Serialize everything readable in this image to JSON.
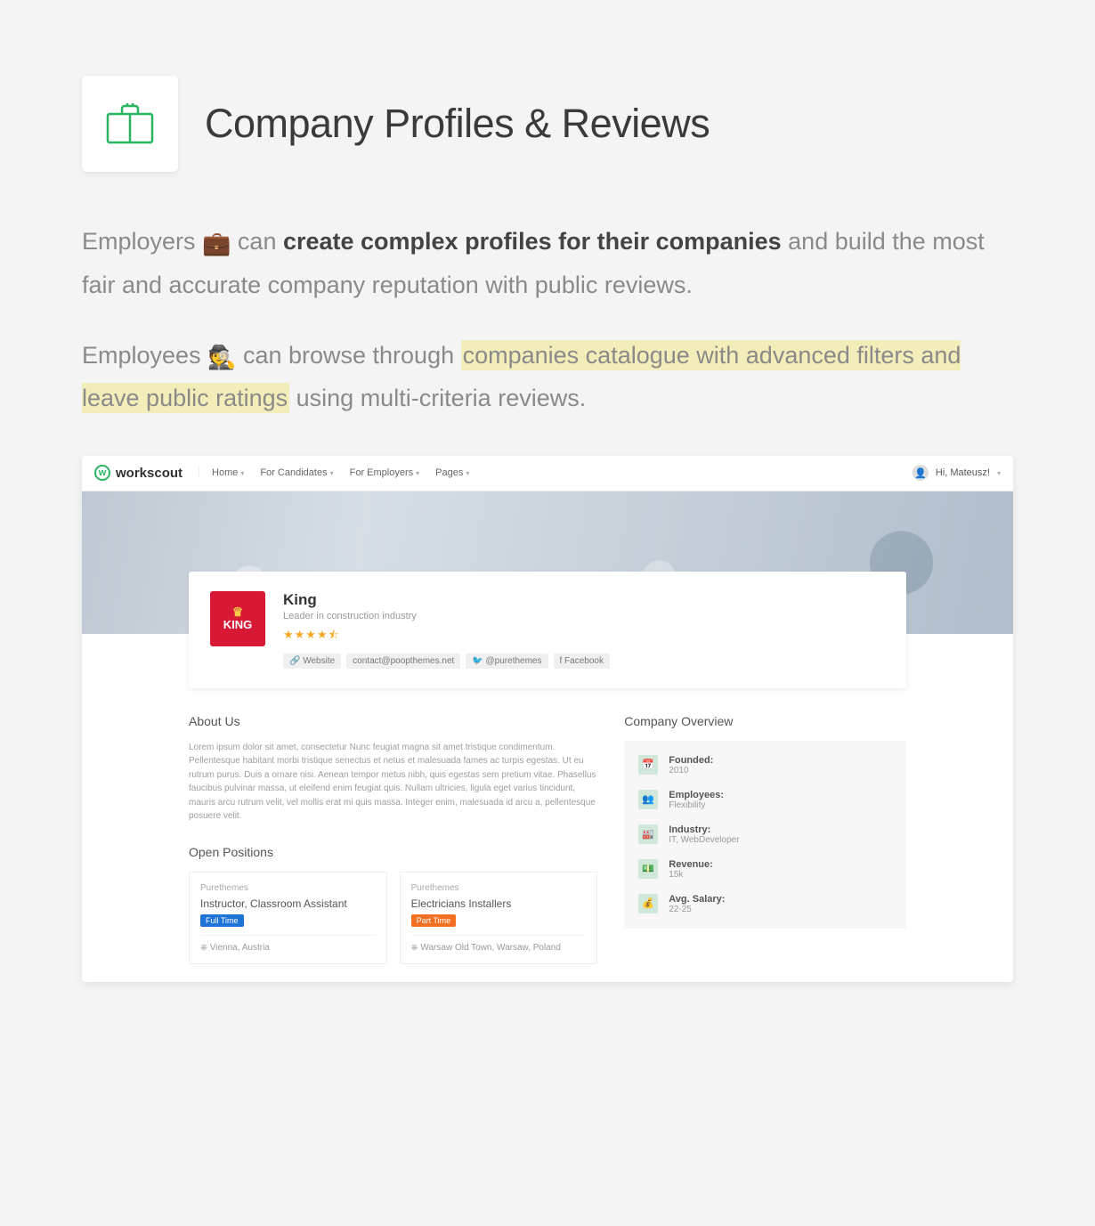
{
  "header": {
    "title": "Company Profiles & Reviews"
  },
  "intro": {
    "p1_lead": "Employers ",
    "p1_emoji": "💼",
    "p1_mid": " can ",
    "p1_strong": "create complex profiles for their companies",
    "p1_tail": " and build the most fair and accurate company reputation with public reviews.",
    "p2_lead": "Employees ",
    "p2_emoji": "🕵️",
    "p2_mid": " can browse through ",
    "p2_hl": "companies catalogue with advanced filters and leave public ratings",
    "p2_tail": " using multi-criteria reviews."
  },
  "screenshot": {
    "brand": "workscout",
    "nav": [
      "Home",
      "For Candidates",
      "For Employers",
      "Pages"
    ],
    "user_greeting": "Hi, Mateusz!",
    "company": {
      "name": "King",
      "tagline": "Leader in construction industry",
      "stars": "★★★★⯪",
      "chips": [
        "🔗 Website",
        "contact@poopthemes.net",
        "🐦 @purethemes",
        "f Facebook"
      ]
    },
    "about_title": "About Us",
    "about_text": "Lorem ipsum dolor sit amet, consectetur Nunc feugiat magna sit amet tristique condimentum. Pellentesque habitant morbi tristique senectus et netus et malesuada fames ac turpis egestas. Ut eu rutrum purus. Duis a ornare nisi. Aenean tempor metus nibh, quis egestas sem pretium vitae. Phasellus faucibus pulvinar massa, ut eleifend enim feugiat quis. Nullam ultricies, ligula eget varius tincidunt, mauris arcu rutrum velit, vel mollis erat mi quis massa. Integer enim, malesuada id arcu a, pellentesque posuere velit.",
    "positions_title": "Open Positions",
    "jobs": [
      {
        "company": "Purethemes",
        "title": "Instructor, Classroom Assistant",
        "tag": "Full Time",
        "tag_class": "tag-blue",
        "location": "⎈ Vienna, Austria"
      },
      {
        "company": "Purethemes",
        "title": "Electricians Installers",
        "tag": "Part Time",
        "tag_class": "tag-orange",
        "location": "⎈ Warsaw Old Town, Warsaw, Poland"
      }
    ],
    "overview_title": "Company Overview",
    "overview": [
      {
        "label": "Founded:",
        "value": "2010"
      },
      {
        "label": "Employees:",
        "value": "Flexibility"
      },
      {
        "label": "Industry:",
        "value": "IT, WebDeveloper"
      },
      {
        "label": "Revenue:",
        "value": "15k"
      },
      {
        "label": "Avg. Salary:",
        "value": "22-25"
      }
    ]
  }
}
